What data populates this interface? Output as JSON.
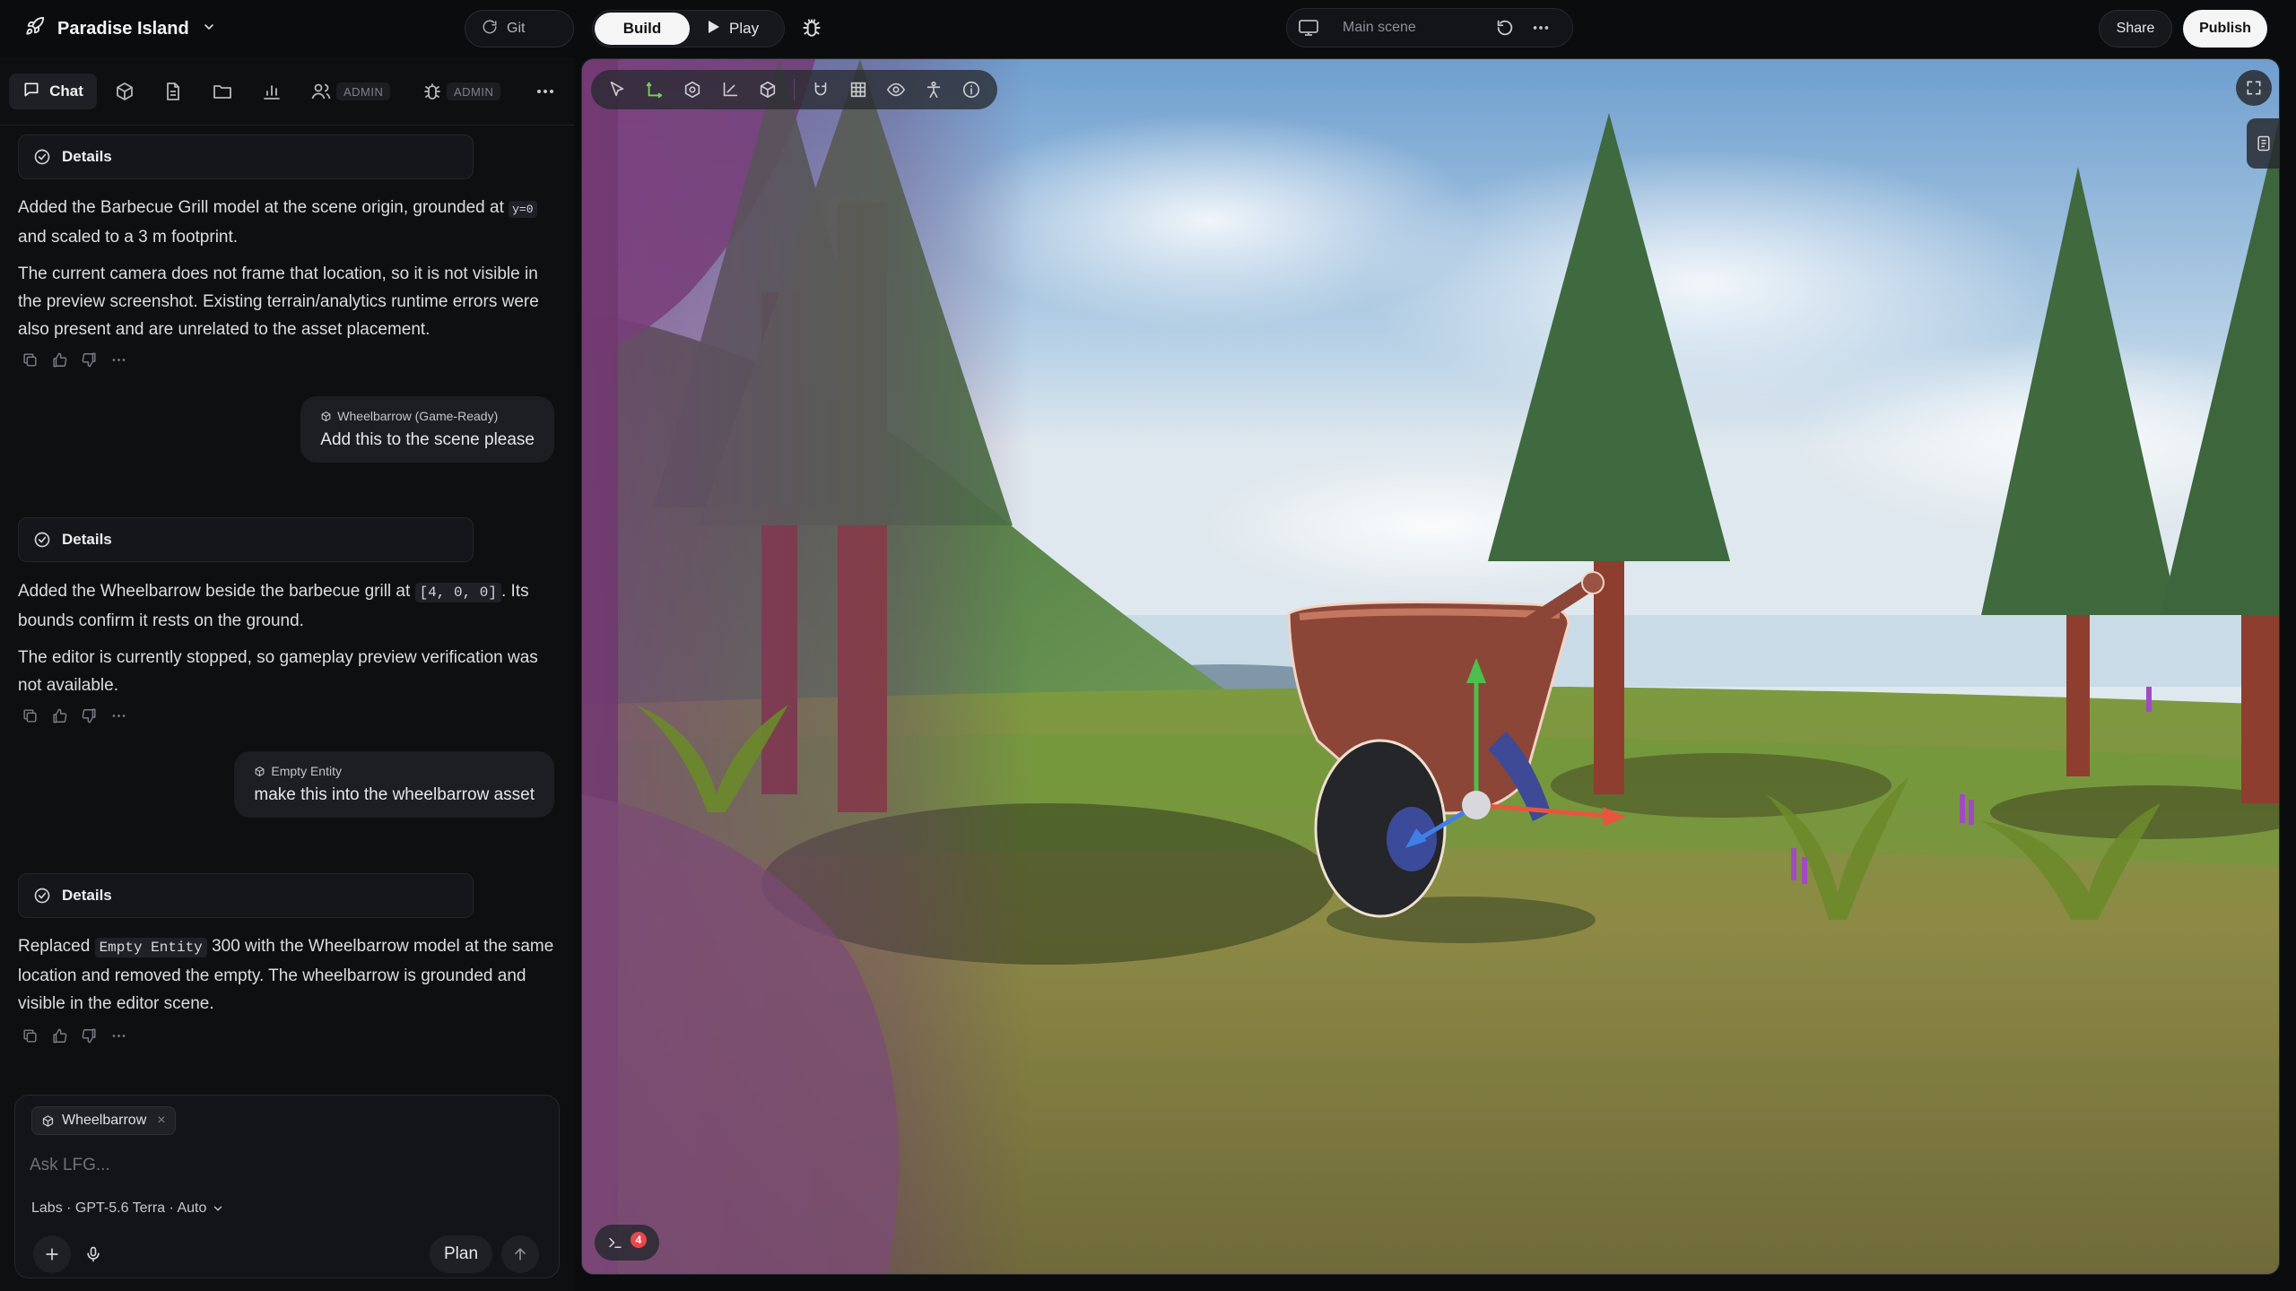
{
  "header": {
    "project_name": "Paradise Island",
    "git_label": "Git",
    "build_label": "Build",
    "play_label": "Play",
    "scene_name": "Main scene",
    "share_label": "Share",
    "publish_label": "Publish"
  },
  "sidebar": {
    "tabs": {
      "chat_label": "Chat",
      "admin_badge_1": "ADMIN",
      "admin_badge_2": "ADMIN"
    }
  },
  "chat": {
    "details_label": "Details",
    "messages": [
      {
        "role": "assistant",
        "text_1a": "Added the Barbecue Grill model at the scene origin, grounded at",
        "code_1": "y=0",
        "text_1b": "and scaled to a 3 m footprint.",
        "text_2": "The current camera does not frame that location, so it is not visible in the preview screenshot. Existing terrain/analytics runtime errors were also present and are unrelated to the asset placement."
      },
      {
        "role": "user",
        "context": "Wheelbarrow (Game-Ready)",
        "text": "Add this to the scene please"
      },
      {
        "role": "assistant",
        "text_1a": "Added the Wheelbarrow beside the barbecue grill at",
        "code_1": "[4, 0, 0]",
        "text_1b": ". Its bounds confirm it rests on the ground.",
        "text_2": "The editor is currently stopped, so gameplay preview verification was not available."
      },
      {
        "role": "user",
        "context": "Empty Entity",
        "text": "make this into the wheelbarrow asset"
      },
      {
        "role": "assistant",
        "text_1a": "Replaced",
        "code_1": "Empty Entity",
        "text_1b": "300 with the Wheelbarrow model at the same location and removed the empty. The wheelbarrow is grounded and visible in the editor scene."
      }
    ]
  },
  "composer": {
    "chip_label": "Wheelbarrow",
    "placeholder": "Ask LFG...",
    "model_label": "Labs · GPT-5.6 Terra · Auto",
    "plan_label": "Plan"
  },
  "viewport": {
    "console_error_count": "4"
  },
  "icons": {
    "project": "rocket-icon",
    "git": "git-icon",
    "play": "play-icon",
    "debug": "bug-icon",
    "scene": "monitor-icon",
    "refresh": "refresh-icon",
    "more": "more-icon",
    "details": "check-circle-icon",
    "copy": "copy-icon",
    "like": "thumbs-up-icon",
    "dislike": "thumbs-down-icon",
    "add": "plus-icon",
    "mic": "mic-icon",
    "send": "arrow-up-icon",
    "fullscreen": "fullscreen-icon",
    "console": "terminal-icon"
  },
  "colors": {
    "background": "#0b0c0e",
    "panel": "#0e0f11",
    "accent_primary": "#f5f5f6",
    "error_badge": "#e5484d",
    "gizmo_x": "#e8553f",
    "gizmo_y": "#4cbf4c",
    "gizmo_z": "#3f7fe8"
  }
}
